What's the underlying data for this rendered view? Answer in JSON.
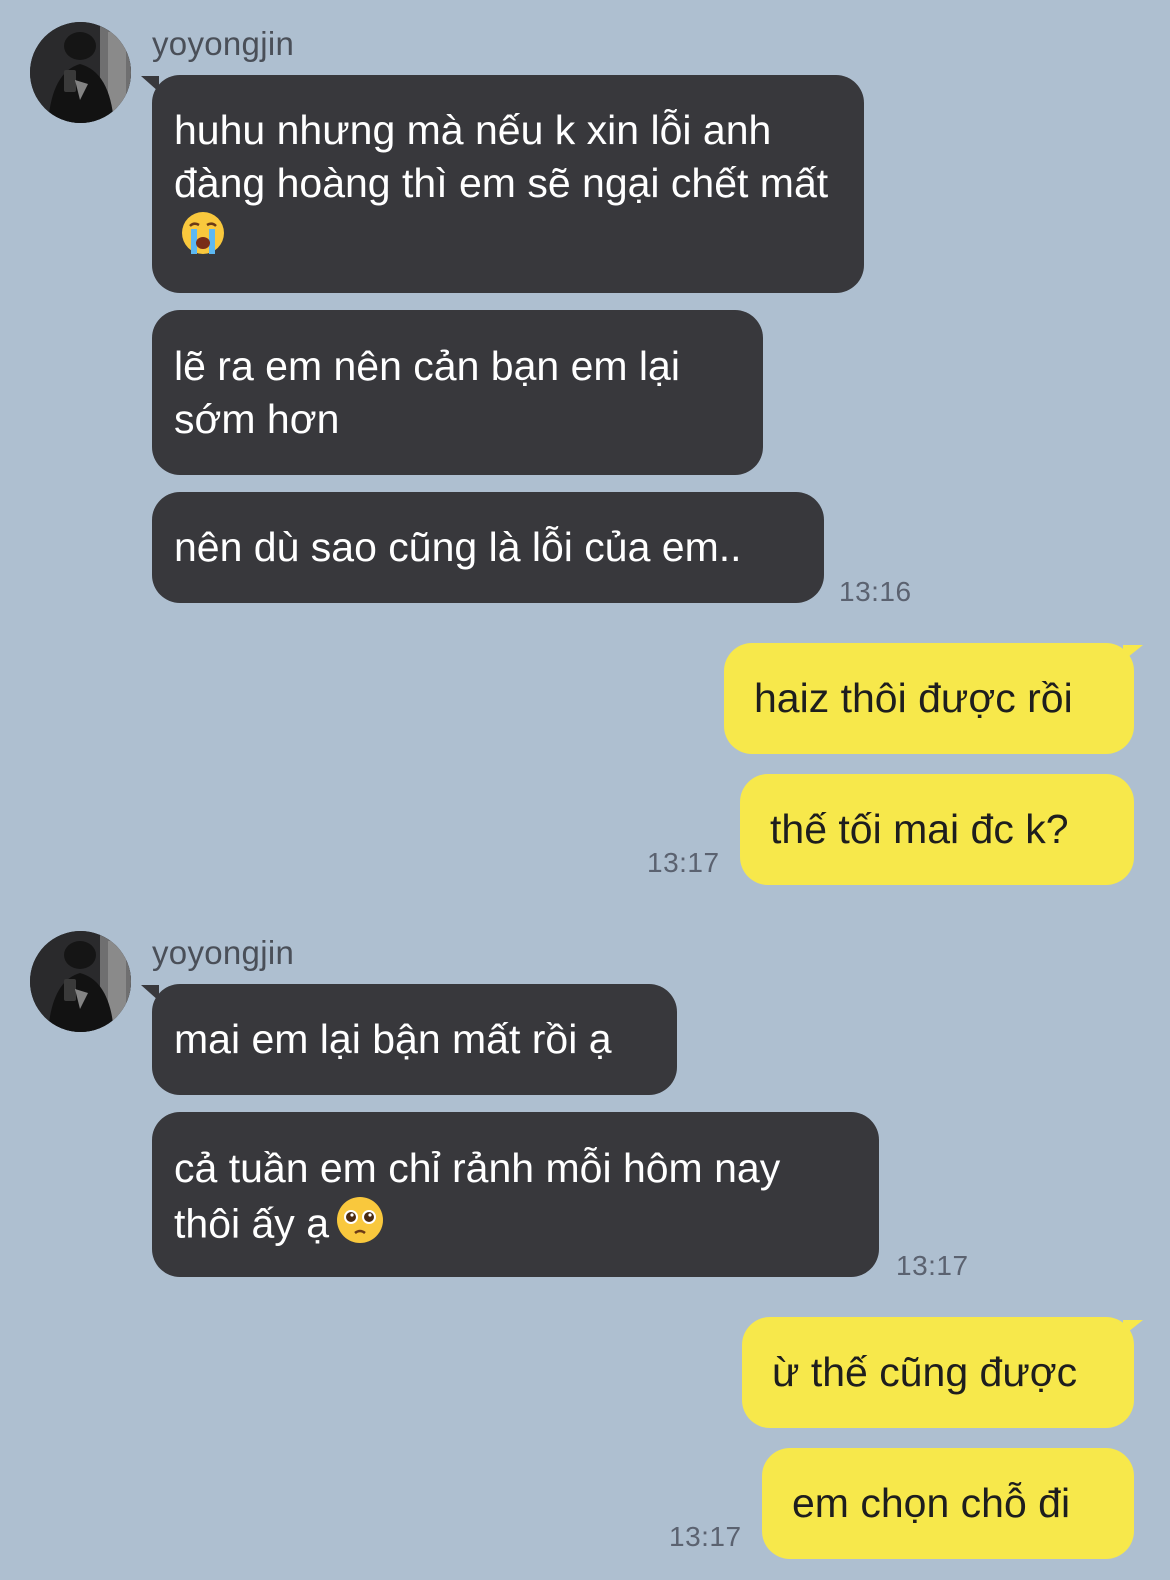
{
  "chat": {
    "group1": {
      "sender": "yoyongjin",
      "messages": [
        "huhu nhưng mà nếu k xin lỗi anh đàng hoàng thì em sẽ ngại chết mất",
        "lẽ ra em nên cản bạn em lại sớm hơn",
        "nên dù sao cũng là lỗi của em.."
      ],
      "time": "13:16",
      "emoji_1": "loudly-crying-face"
    },
    "group2": {
      "messages": [
        "haiz thôi được rồi",
        "thế tối mai đc k?"
      ],
      "time": "13:17"
    },
    "group3": {
      "sender": "yoyongjin",
      "messages": [
        "mai em lại bận mất rồi ạ",
        "cả tuần em chỉ rảnh mỗi hôm nay thôi ấy ạ"
      ],
      "time": "13:17",
      "emoji_2": "pleading-face"
    },
    "group4": {
      "messages": [
        "ừ thế cũng được",
        "em chọn chỗ đi"
      ],
      "time": "13:17"
    }
  },
  "colors": {
    "background": "#aebfd0",
    "incoming_bubble": "#38383c",
    "outgoing_bubble": "#f7e84b"
  }
}
